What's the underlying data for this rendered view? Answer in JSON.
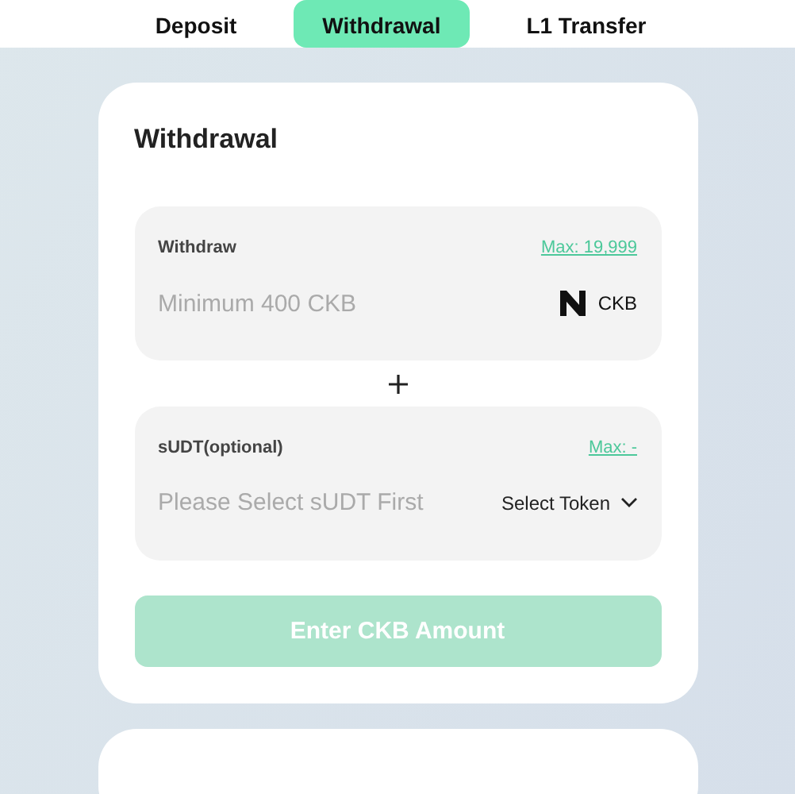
{
  "tabs": [
    {
      "label": "Deposit",
      "selected": false
    },
    {
      "label": "Withdrawal",
      "selected": true
    },
    {
      "label": "L1 Transfer",
      "selected": false
    }
  ],
  "card": {
    "title": "Withdrawal",
    "fields": [
      {
        "label": "Withdraw",
        "max": "Max: 19,999",
        "placeholder": "Minimum 400 CKB",
        "kind": "token",
        "token": "CKB"
      },
      {
        "label": "sUDT(optional)",
        "max": "Max: -",
        "placeholder": "Please Select sUDT First",
        "kind": "select",
        "token": "Select Token"
      }
    ],
    "submit": {
      "label": "Enter CKB Amount",
      "disabled": true
    }
  }
}
